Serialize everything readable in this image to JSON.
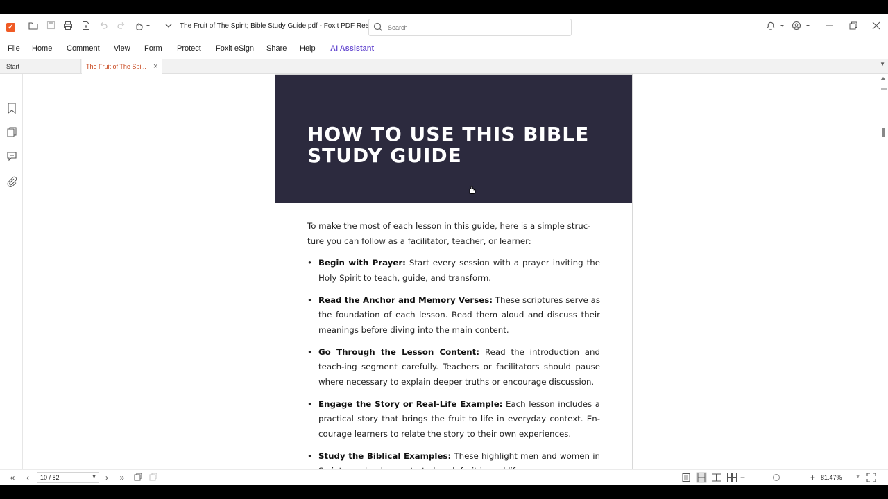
{
  "app": {
    "window_title": "The Fruit of The Spirit; Bible Study Guide.pdf - Foxit PDF Reader",
    "logo_glyph": "✓"
  },
  "search": {
    "placeholder": "Search"
  },
  "menu": [
    "File",
    "Home",
    "Comment",
    "View",
    "Form",
    "Protect",
    "Foxit eSign",
    "Share",
    "Help",
    "AI Assistant"
  ],
  "tabs": {
    "start": "Start",
    "active": "The Fruit of The Spi..."
  },
  "page": {
    "heading": "HOW TO USE THIS BIBLE STUDY GUIDE",
    "intro": "To make the most of each lesson in this guide, here is a simple struc-ture you can follow as a facilitator, teacher, or learner:",
    "items": [
      {
        "title": "Begin with Prayer:",
        "text": " Start every session with a prayer inviting the Holy Spirit to teach, guide, and transform."
      },
      {
        "title": "Read the Anchor and Memory Verses:",
        "text": " These scriptures serve as the foundation of each lesson. Read them aloud and discuss their meanings before diving into the main content."
      },
      {
        "title": "Go Through the Lesson Content:",
        "text": " Read the introduction and teach-ing segment carefully. Teachers or facilitators should pause where necessary to explain deeper truths or encourage discussion."
      },
      {
        "title": "Engage the Story or Real-Life Example:",
        "text": " Each lesson includes a practical story that brings the fruit to life in everyday context. En-courage learners to relate the story to their own experiences."
      },
      {
        "title": "Study the Biblical Examples:",
        "text": " These highlight men and women in Scripture who demonstrated each fruit in real life."
      }
    ]
  },
  "status": {
    "page_indicator": "10 / 82",
    "zoom": "81.47%",
    "zoom_fraction": 0.45
  },
  "colors": {
    "accent": "#c8461c",
    "header_band": "#2c2a3e",
    "ai_assistant": "#6a4fd1"
  }
}
